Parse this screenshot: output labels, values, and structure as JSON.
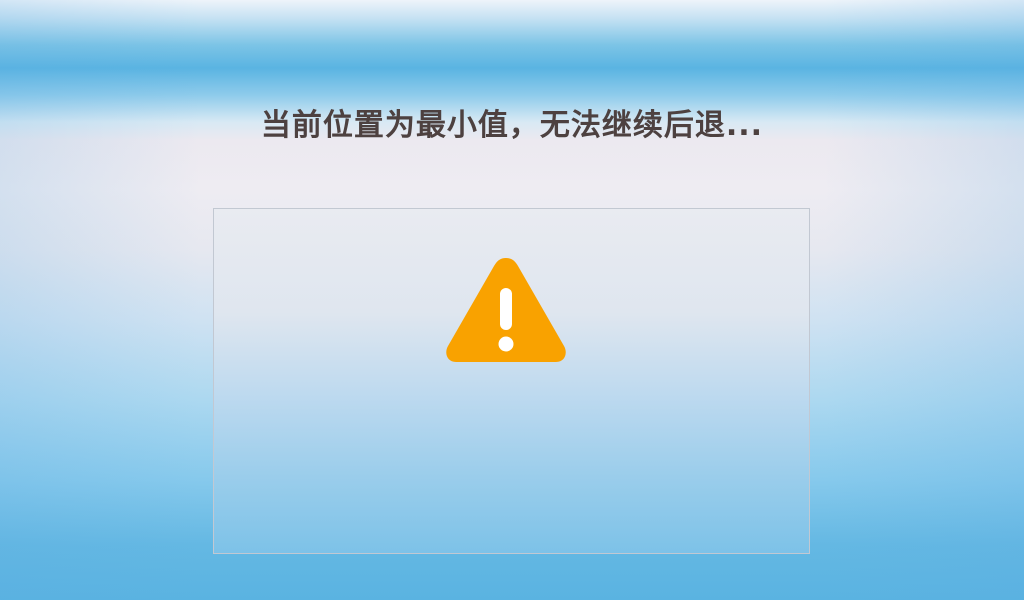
{
  "message": "当前位置为最小值，无法继续后退...",
  "colors": {
    "text": "#4d4140",
    "warning_orange": "#f9a200",
    "panel_border": "#c2c8d2"
  },
  "icon": {
    "name": "warning-icon"
  }
}
